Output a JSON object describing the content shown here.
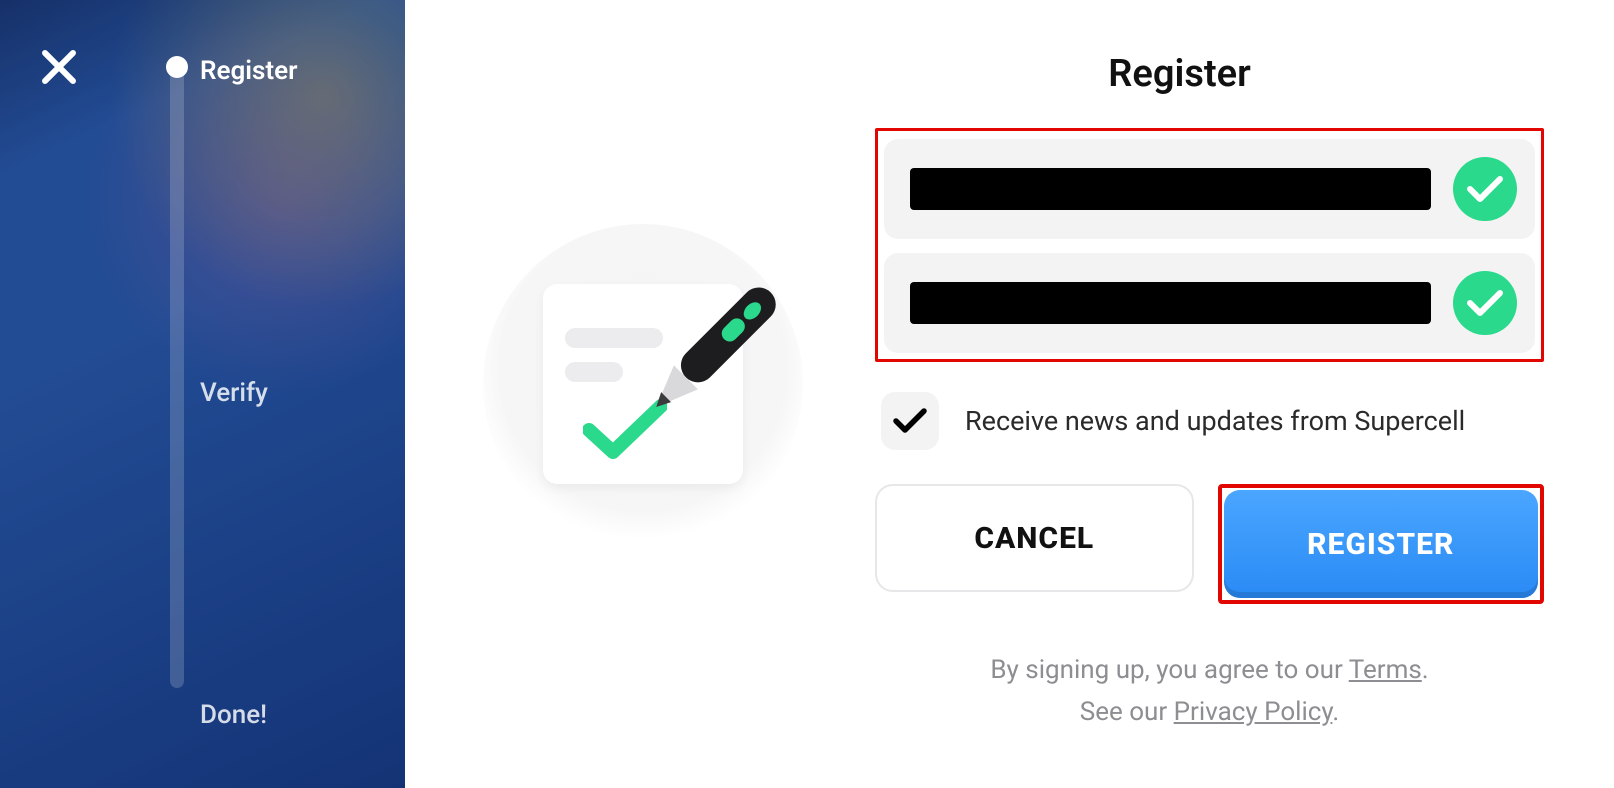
{
  "sidebar": {
    "steps": [
      {
        "label": "Register",
        "active": true
      },
      {
        "label": "Verify",
        "active": false
      },
      {
        "label": "Done!",
        "active": false
      }
    ]
  },
  "main": {
    "title": "Register",
    "consent_label": "Receive news and updates from Supercell",
    "consent_checked": true,
    "cancel_label": "CANCEL",
    "register_label": "REGISTER",
    "legal_prefix": "By signing up, you agree to our ",
    "legal_terms": "Terms",
    "legal_suffix": ".",
    "legal_line2_prefix": "See our ",
    "legal_privacy": "Privacy Policy",
    "legal_line2_suffix": "."
  },
  "colors": {
    "accent_green": "#2ad98b",
    "accent_blue": "#2a8af5",
    "highlight_red": "#e10600"
  }
}
